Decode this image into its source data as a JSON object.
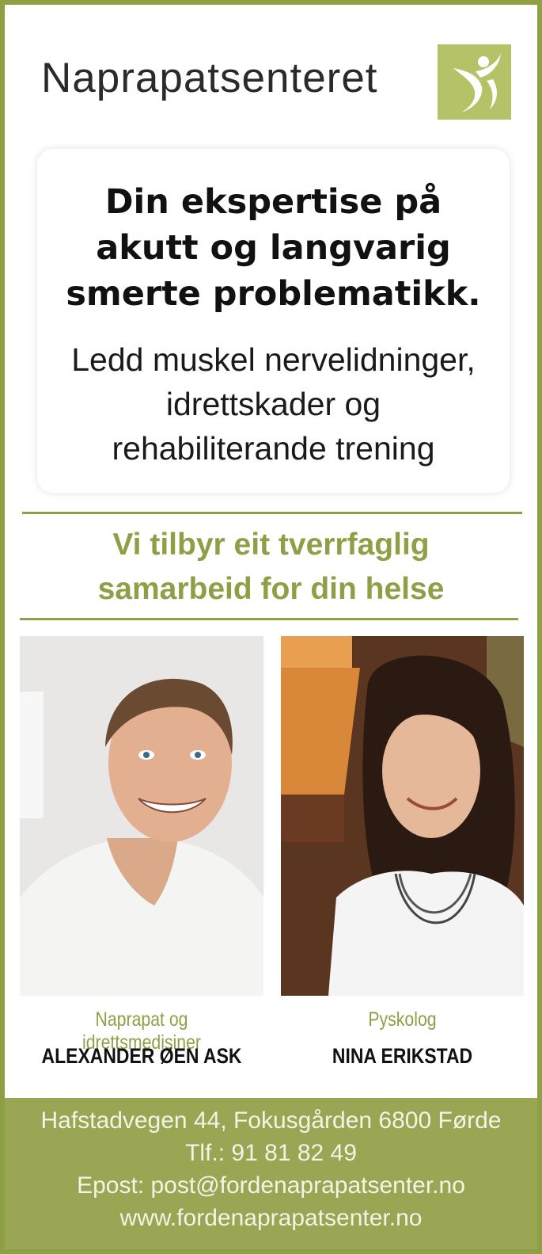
{
  "brand": {
    "name": "Naprapatsenteret",
    "accent_color": "#8f9f46",
    "logo_color": "#b6c268"
  },
  "headline": {
    "lines": [
      "Din ekspertise på",
      "akutt og langvarig",
      "smerte problematikk."
    ]
  },
  "subline": {
    "lines": [
      "Ledd muskel nervelidninger,",
      "idrettskader og",
      "rehabiliterande trening"
    ]
  },
  "offer": {
    "lines": [
      "Vi tilbyr eit tverrfaglig",
      "samarbeid for din helse"
    ]
  },
  "people": [
    {
      "role": "Naprapat og idrettsmedisiner",
      "name": "ALEXANDER ØEN ASK"
    },
    {
      "role": "Pyskolog",
      "name": "NINA ERIKSTAD"
    }
  ],
  "footer": {
    "address": "Hafstadvegen 44, Fokusgården 6800 Førde",
    "phone": "Tlf.: 91 81 82 49",
    "email": "Epost: post@fordenaprapatsenter.no",
    "website": "www.fordenaprapatsenter.no"
  }
}
